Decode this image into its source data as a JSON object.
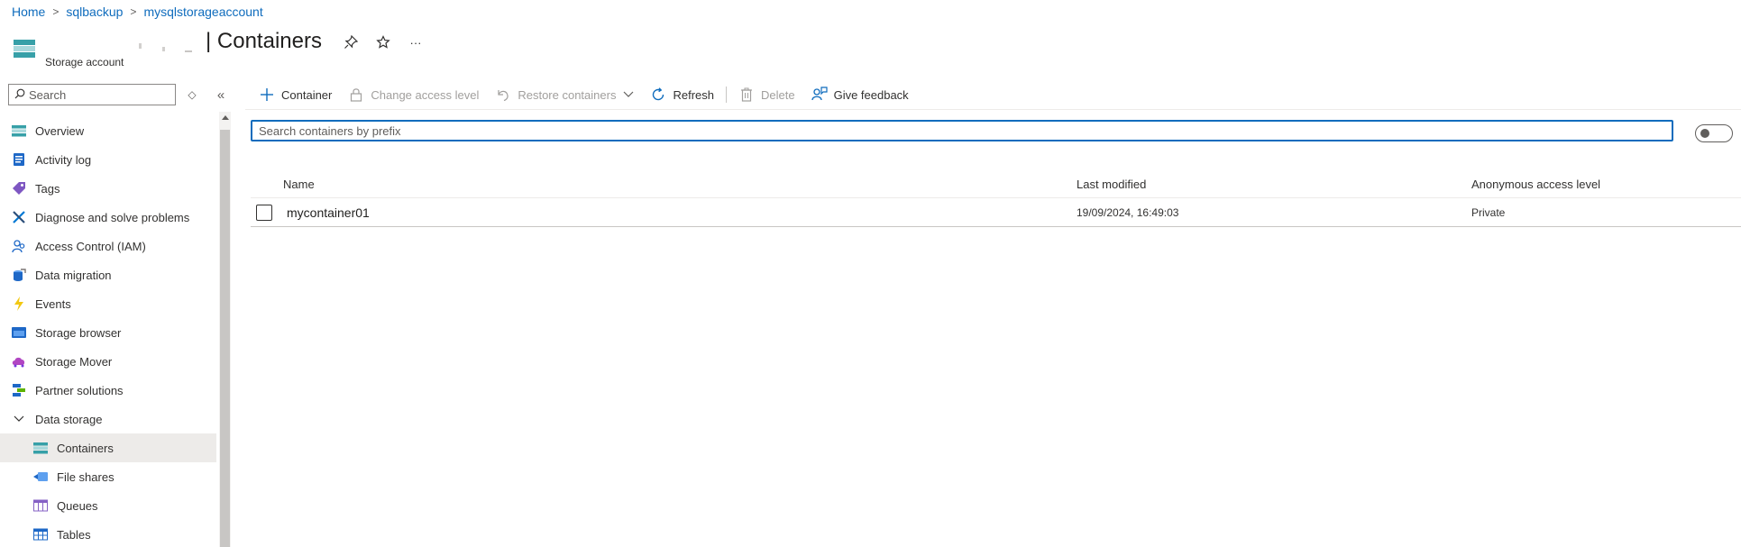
{
  "breadcrumb": {
    "items": [
      "Home",
      "sqlbackup",
      "mysqlstorageaccount"
    ],
    "separator": ">"
  },
  "header": {
    "title": "| Containers",
    "resource_type": "Storage account",
    "more_label": "···"
  },
  "sidebar": {
    "search_placeholder": "Search",
    "collapse_label": "«",
    "sort_label": "◇",
    "items": [
      {
        "label": "Overview",
        "icon": "overview-icon"
      },
      {
        "label": "Activity log",
        "icon": "activity-log-icon"
      },
      {
        "label": "Tags",
        "icon": "tag-icon"
      },
      {
        "label": "Diagnose and solve problems",
        "icon": "wrench-icon"
      },
      {
        "label": "Access Control (IAM)",
        "icon": "people-icon"
      },
      {
        "label": "Data migration",
        "icon": "data-migration-icon"
      },
      {
        "label": "Events",
        "icon": "lightning-icon"
      },
      {
        "label": "Storage browser",
        "icon": "storage-browser-icon"
      },
      {
        "label": "Storage Mover",
        "icon": "cloud-mover-icon"
      },
      {
        "label": "Partner solutions",
        "icon": "partner-icon"
      }
    ],
    "group": {
      "label": "Data storage"
    },
    "sub_items": [
      {
        "label": "Containers",
        "icon": "containers-icon",
        "active": true
      },
      {
        "label": "File shares",
        "icon": "file-share-icon"
      },
      {
        "label": "Queues",
        "icon": "queue-icon"
      },
      {
        "label": "Tables",
        "icon": "table-icon"
      }
    ]
  },
  "toolbar": {
    "container_label": "Container",
    "change_access_label": "Change access level",
    "restore_label": "Restore containers",
    "refresh_label": "Refresh",
    "delete_label": "Delete",
    "feedback_label": "Give feedback"
  },
  "search": {
    "placeholder": "Search containers by prefix"
  },
  "table": {
    "columns": [
      "Name",
      "Last modified",
      "Anonymous access level"
    ],
    "rows": [
      {
        "name": "mycontainer01",
        "last_modified": "19/09/2024, 16:49:03",
        "access": "Private"
      }
    ]
  },
  "colors": {
    "accent": "#0f6cbd",
    "active_bg": "#edebe9"
  }
}
